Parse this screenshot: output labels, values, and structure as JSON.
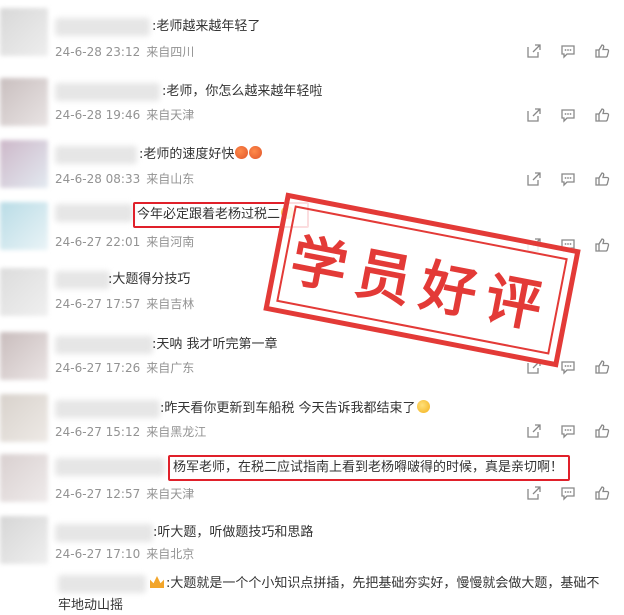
{
  "comments": [
    {
      "text": ":老师越来越年轻了",
      "time": "24-6-28 23:12",
      "location": "来自四川"
    },
    {
      "text": ":老师，你怎么越来越年轻啦",
      "time": "24-6-28 19:46",
      "location": "来自天津"
    },
    {
      "text": ":老师的速度好快",
      "time": "24-6-28 08:33",
      "location": "来自山东"
    },
    {
      "text": "今年必定跟着老杨过税二",
      "time": "24-6-27 22:01",
      "location": "来自河南"
    },
    {
      "text": ":大题得分技巧",
      "time": "24-6-27 17:57",
      "location": "来自吉林"
    },
    {
      "text": ":天呐 我才听完第一章",
      "time": "24-6-27 17:26",
      "location": "来自广东"
    },
    {
      "text": ":昨天看你更新到车船税 今天告诉我都结束了",
      "time": "24-6-27 15:12",
      "location": "来自黑龙江"
    },
    {
      "text": "杨军老师，在税二应试指南上看到老杨嘚啵得的时候，真是亲切啊！",
      "time": "24-6-27 12:57",
      "location": "来自天津"
    },
    {
      "text": ":听大题，听做题技巧和思路",
      "time": "24-6-27 17:10",
      "location": "来自北京"
    },
    {
      "text": ":大题就是一个个小知识点拼插，先把基础夯实好，慢慢就会做大题，基础不",
      "text2": "牢地动山摇"
    }
  ],
  "stamp_text": "学员好评",
  "colors": {
    "stamp": "#e33a37",
    "highlight": "#e0202a",
    "meta": "#939393"
  },
  "icons": [
    "share-icon",
    "comment-icon",
    "like-icon"
  ]
}
